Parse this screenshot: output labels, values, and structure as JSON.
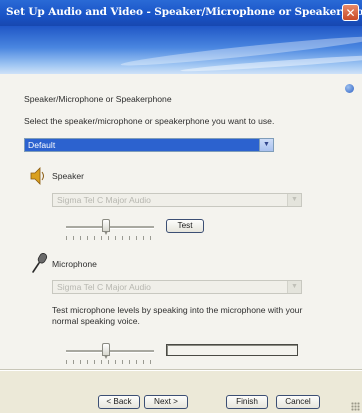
{
  "window": {
    "title": "Set Up Audio and Video - Speaker/Microphone or Speakerphone",
    "close_glyph": "✕"
  },
  "section": {
    "title": "Speaker/Microphone or Speakerphone",
    "instruction": "Select the speaker/microphone or speakerphone you want to use.",
    "device_value": "Default"
  },
  "speaker": {
    "label": "Speaker",
    "device_value": "Sigma Tel C Major Audio",
    "volume_level": 0.45,
    "test_label": "Test"
  },
  "microphone": {
    "label": "Microphone",
    "device_value": "Sigma Tel C Major Audio",
    "instruction": "Test microphone levels by speaking into the microphone with your normal speaking voice.",
    "volume_level": 0.45,
    "input_level": 0.0
  },
  "footer": {
    "back_label": "< Back",
    "next_label": "Next >",
    "finish_label": "Finish",
    "cancel_label": "Cancel"
  },
  "colors": {
    "title_bar": "#1a55c8",
    "selected_dropdown": "#2c62cf",
    "background": "#ece9d8"
  },
  "icons": [
    "close-icon",
    "help-icon",
    "speaker-icon",
    "microphone-icon",
    "chevron-down-icon"
  ]
}
